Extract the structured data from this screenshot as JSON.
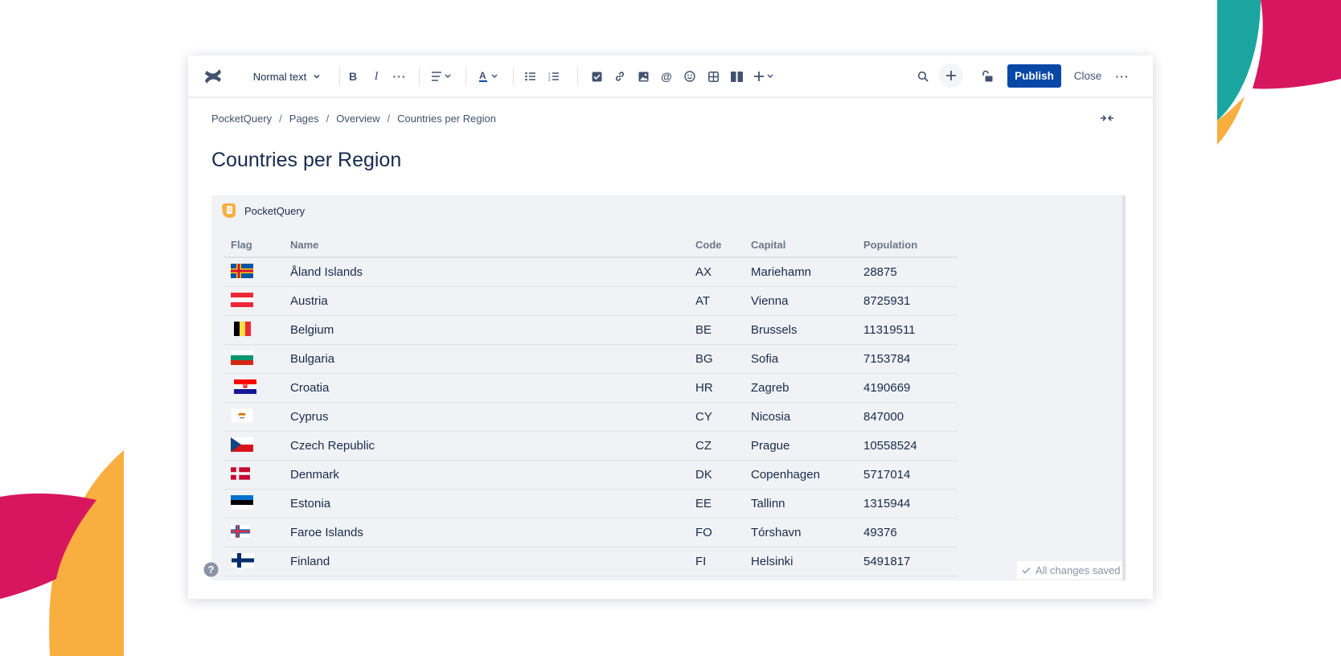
{
  "colors": {
    "accent": "#0747a6",
    "deco_pink": "#d8165f",
    "deco_orange": "#f9ae40",
    "deco_teal": "#1aa5a0",
    "macro_bg": "#f1f2f5"
  },
  "toolbar": {
    "logo_icon": "confluence-logo-icon",
    "text_style": "Normal text",
    "publish_label": "Publish",
    "close_label": "Close"
  },
  "breadcrumb": {
    "items": [
      "PocketQuery",
      "Pages",
      "Overview",
      "Countries per Region"
    ],
    "separator": "/"
  },
  "page": {
    "title": "Countries per Region"
  },
  "macro": {
    "name": "PocketQuery",
    "columns": [
      "Flag",
      "Name",
      "Code",
      "Capital",
      "Population"
    ],
    "rows": [
      {
        "flag": "aland-flag-icon",
        "name": "Åland Islands",
        "code": "AX",
        "capital": "Mariehamn",
        "population": "28875"
      },
      {
        "flag": "austria-flag-icon",
        "name": "Austria",
        "code": "AT",
        "capital": "Vienna",
        "population": "8725931"
      },
      {
        "flag": "belgium-flag-icon",
        "name": "Belgium",
        "code": "BE",
        "capital": "Brussels",
        "population": "11319511"
      },
      {
        "flag": "bulgaria-flag-icon",
        "name": "Bulgaria",
        "code": "BG",
        "capital": "Sofia",
        "population": "7153784"
      },
      {
        "flag": "croatia-flag-icon",
        "name": "Croatia",
        "code": "HR",
        "capital": "Zagreb",
        "population": "4190669"
      },
      {
        "flag": "cyprus-flag-icon",
        "name": "Cyprus",
        "code": "CY",
        "capital": "Nicosia",
        "population": "847000"
      },
      {
        "flag": "czech-flag-icon",
        "name": "Czech Republic",
        "code": "CZ",
        "capital": "Prague",
        "population": "10558524"
      },
      {
        "flag": "denmark-flag-icon",
        "name": "Denmark",
        "code": "DK",
        "capital": "Copenhagen",
        "population": "5717014"
      },
      {
        "flag": "estonia-flag-icon",
        "name": "Estonia",
        "code": "EE",
        "capital": "Tallinn",
        "population": "1315944"
      },
      {
        "flag": "faroe-flag-icon",
        "name": "Faroe Islands",
        "code": "FO",
        "capital": "Tórshavn",
        "population": "49376"
      },
      {
        "flag": "finland-flag-icon",
        "name": "Finland",
        "code": "FI",
        "capital": "Helsinki",
        "population": "5491817"
      }
    ]
  },
  "status": {
    "saved_text": "All changes saved"
  }
}
